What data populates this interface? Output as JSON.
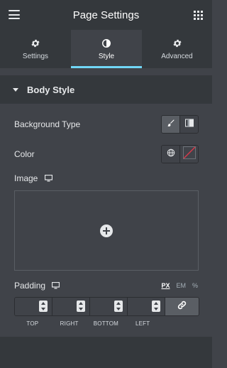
{
  "header": {
    "title": "Page Settings",
    "menu_icon": "hamburger-icon",
    "apps_icon": "grid-icon"
  },
  "tabs": [
    {
      "label": "Settings",
      "icon": "gear-icon",
      "active": false
    },
    {
      "label": "Style",
      "icon": "half-circle-icon",
      "active": true
    },
    {
      "label": "Advanced",
      "icon": "gear-icon",
      "active": false
    }
  ],
  "section": {
    "title": "Body Style",
    "expanded": true
  },
  "fields": {
    "background_type": {
      "label": "Background Type",
      "options": [
        "brush-icon",
        "gradient-icon"
      ],
      "selected": "brush-icon"
    },
    "color": {
      "label": "Color",
      "options": [
        "globe-icon",
        "no-color-swatch"
      ]
    },
    "image": {
      "label": "Image",
      "device_icon": "desktop-icon",
      "add_icon": "plus-circle-icon"
    },
    "padding": {
      "label": "Padding",
      "device_icon": "desktop-icon",
      "units": [
        "PX",
        "EM",
        "%"
      ],
      "selected_unit": "PX",
      "sides": [
        "TOP",
        "RIGHT",
        "BOTTOM",
        "LEFT"
      ],
      "values": [
        "",
        "",
        "",
        ""
      ],
      "link_icon": "link-icon"
    }
  },
  "colors": {
    "accent": "#71d7f7",
    "panel": "#404349",
    "header": "#34383c",
    "swatch_none": "#d9384a"
  }
}
